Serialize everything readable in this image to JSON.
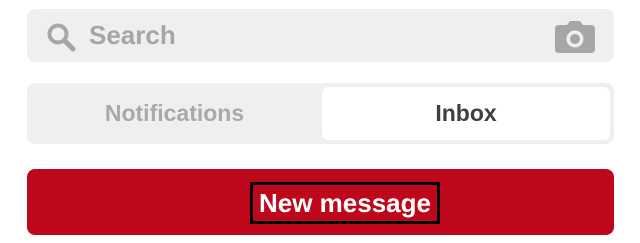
{
  "search": {
    "placeholder": "Search",
    "leading_icon": "search-icon",
    "trailing_icon": "camera-icon"
  },
  "tabs": [
    {
      "label": "Notifications",
      "selected": false
    },
    {
      "label": "Inbox",
      "selected": true
    }
  ],
  "actions": {
    "new_message_label": "New message"
  },
  "colors": {
    "primary": "#bd081c",
    "field_background": "#efefef",
    "placeholder_text": "#a6a6a6",
    "selected_tab_text": "#3f3f3f",
    "unselected_tab_text": "#a9a9a9"
  }
}
